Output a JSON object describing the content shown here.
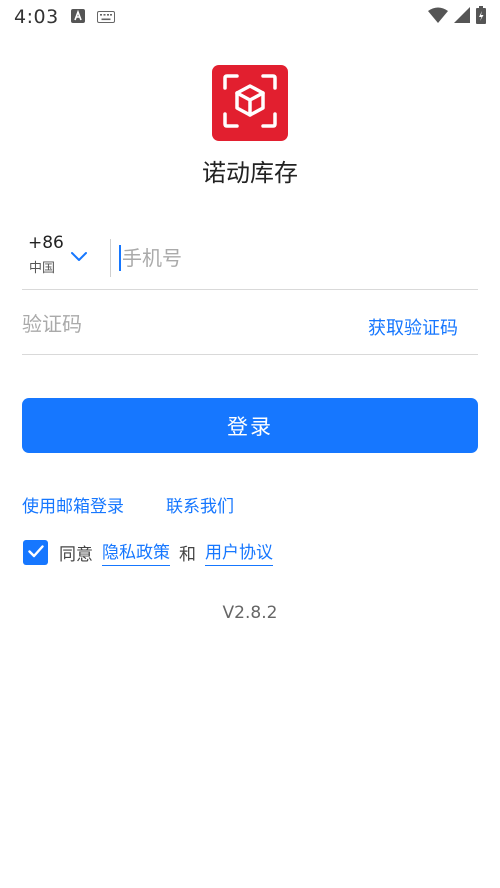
{
  "status_bar": {
    "time": "4:03"
  },
  "app": {
    "name": "诺动库存"
  },
  "phone": {
    "country_code": "+86",
    "country_name": "中国",
    "placeholder": "手机号",
    "value": ""
  },
  "verification": {
    "placeholder": "验证码",
    "value": "",
    "get_code_label": "获取验证码"
  },
  "login_button": {
    "label": "登录"
  },
  "links": {
    "email_login": "使用邮箱登录",
    "contact_us": "联系我们"
  },
  "agreement": {
    "checked": true,
    "prefix": "同意",
    "privacy_policy": "隐私政策",
    "conjunction": "和",
    "user_agreement": "用户协议"
  },
  "version": "V2.8.2",
  "colors": {
    "accent": "#1677ff",
    "brand": "#e21f2f"
  },
  "icons": [
    "text-icon",
    "keyboard-icon",
    "wifi-icon",
    "signal-icon",
    "battery-icon",
    "scan-box-icon",
    "chevron-down-icon",
    "checkmark-icon"
  ]
}
